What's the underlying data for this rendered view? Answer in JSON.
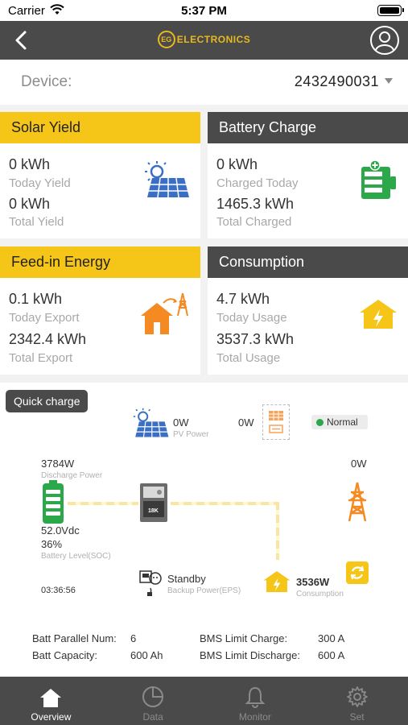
{
  "status_bar": {
    "carrier": "Carrier",
    "time": "5:37 PM"
  },
  "header": {
    "logo_mark": "EG",
    "logo_text": "ELECTRONICS"
  },
  "device": {
    "label": "Device:",
    "value": "2432490031"
  },
  "cards": {
    "solar_yield": {
      "title": "Solar Yield",
      "today_value": "0 kWh",
      "today_label": "Today Yield",
      "total_value": "0 kWh",
      "total_label": "Total Yield"
    },
    "battery_charge": {
      "title": "Battery Charge",
      "today_value": "0 kWh",
      "today_label": "Charged Today",
      "total_value": "1465.3 kWh",
      "total_label": "Total Charged"
    },
    "feed_in": {
      "title": "Feed-in Energy",
      "today_value": "0.1 kWh",
      "today_label": "Today Export",
      "total_value": "2342.4 kWh",
      "total_label": "Total Export"
    },
    "consumption": {
      "title": "Consumption",
      "today_value": "4.7 kWh",
      "today_label": "Today Usage",
      "total_value": "3537.3 kWh",
      "total_label": "Total Usage"
    }
  },
  "flow": {
    "quick_charge": "Quick charge",
    "pv_power_value": "0W",
    "pv_power_label": "PV Power",
    "generator_value": "0W",
    "status": "Normal",
    "discharge_value": "3784W",
    "discharge_label": "Discharge Power",
    "battery_voltage": "52.0Vdc",
    "battery_soc": "36%",
    "battery_label": "Battery Level(SOC)",
    "grid_value": "0W",
    "inverter_label": "18K",
    "backup_status": "Standby",
    "backup_label": "Backup Power(EPS)",
    "consumption_value": "3536W",
    "consumption_label": "Consumption",
    "time": "03:36:56"
  },
  "stats": {
    "batt_parallel_label": "Batt Parallel Num:",
    "batt_parallel_value": "6",
    "batt_capacity_label": "Batt Capacity:",
    "batt_capacity_value": "600 Ah",
    "bms_charge_label": "BMS Limit Charge:",
    "bms_charge_value": "300 A",
    "bms_discharge_label": "BMS Limit Discharge:",
    "bms_discharge_value": "600 A"
  },
  "tabs": [
    {
      "label": "Overview",
      "icon": "home-icon",
      "active": true
    },
    {
      "label": "Data",
      "icon": "pie-chart-icon",
      "active": false
    },
    {
      "label": "Monitor",
      "icon": "bell-icon",
      "active": false
    },
    {
      "label": "Set",
      "icon": "gear-icon",
      "active": false
    }
  ],
  "colors": {
    "accent_yellow": "#f5c518",
    "dark_gray": "#4a4a4a",
    "green": "#2ba84a",
    "orange": "#f58a22",
    "solar_blue": "#3a6fc4"
  }
}
